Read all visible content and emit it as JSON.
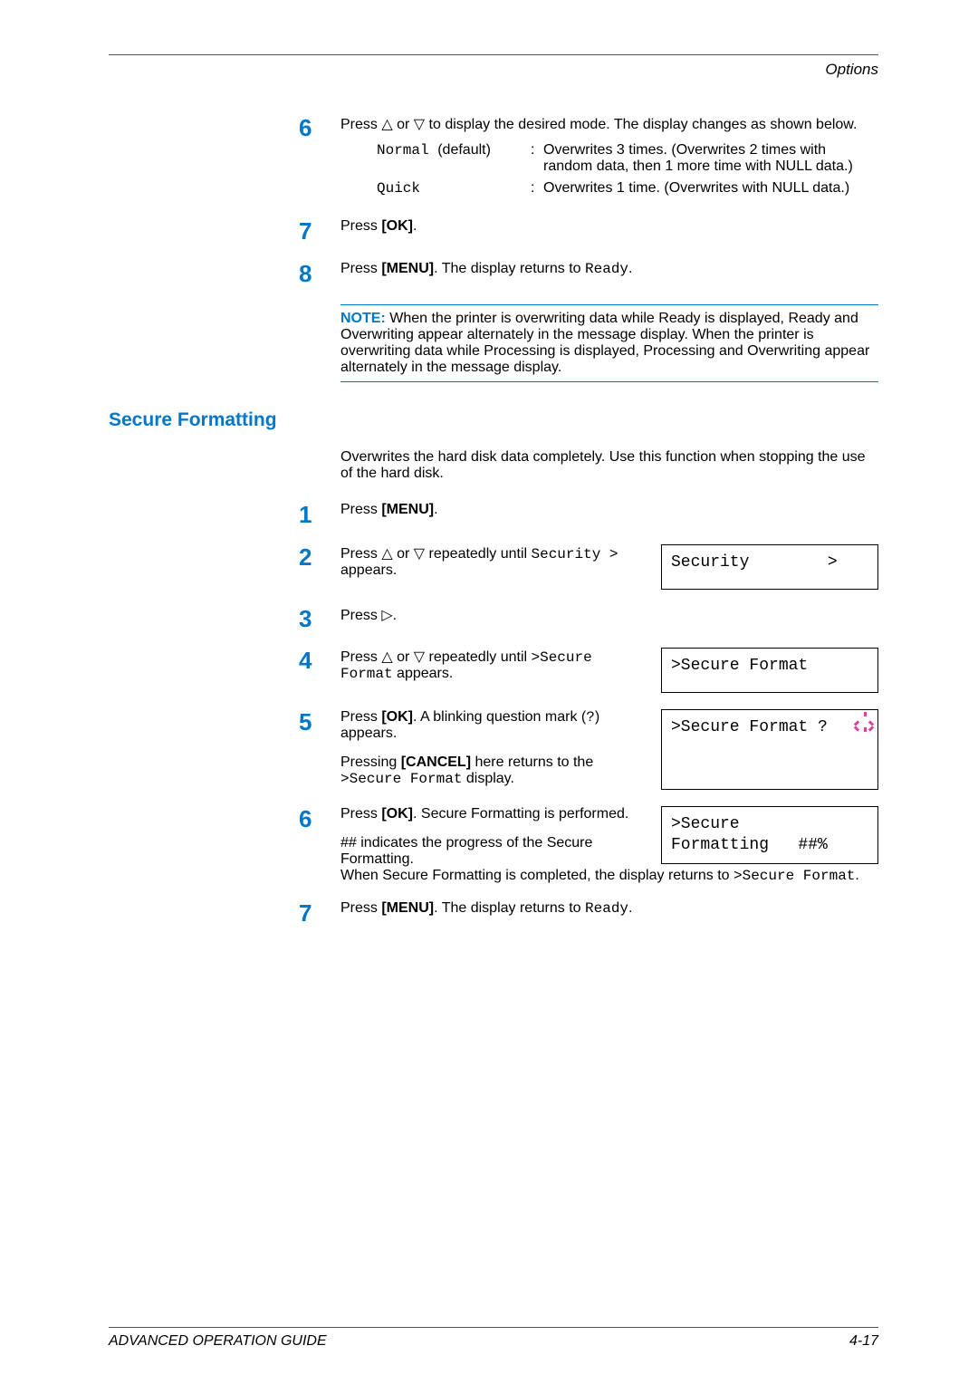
{
  "header": {
    "title": "Options"
  },
  "steps_a": [
    {
      "num": "6",
      "text": "Press △ or ▽ to display the desired mode. The display changes as shown below."
    },
    {
      "num": "7",
      "text": "Press ",
      "bold1": "[OK]",
      "tail": "."
    },
    {
      "num": "8",
      "text": "Press ",
      "bold1": "[MENU]",
      "tail": ". The display returns to ",
      "mono1": "Ready",
      "tail2": "."
    }
  ],
  "modes": {
    "k1_code": "Normal",
    "k1_paren": "(default)",
    "k1_desc": "Overwrites 3 times. (Overwrites 2 times with random data, then 1 more time with NULL data.)",
    "k2_code": "Quick",
    "k2_desc": "Overwrites 1 time. (Overwrites with NULL data.)"
  },
  "note": {
    "label": "NOTE:",
    "text": "When the printer is overwriting data while Ready is displayed, Ready and Overwriting appear alternately in the message display. When the printer is overwriting data while Processing is displayed, Processing and Overwriting appear alternately in the message display."
  },
  "section": {
    "title": "Secure Formatting",
    "intro": "Overwrites the hard disk data completely. Use this function when stopping the use of the hard disk."
  },
  "steps_b": {
    "s1": {
      "num": "1",
      "pre": "Press ",
      "bold": "[MENU]",
      "post": "."
    },
    "s2": {
      "num": "2",
      "pre": "Press △ or ▽ repeatedly until ",
      "mono": "Security >",
      "post": " appears.",
      "display": "Security        >"
    },
    "s3": {
      "num": "3",
      "pre": "Press ▷."
    },
    "s4": {
      "num": "4",
      "pre": "Press △ or ▽ repeatedly until ",
      "mono": ">Secure Format",
      "post": " appears.",
      "display": ">Secure Format"
    },
    "s5": {
      "num": "5",
      "pre": "Press ",
      "bold": "[OK]",
      "post": ". A blinking question mark (",
      "mono": "?",
      "post2": ") appears.",
      "line2": "Pressing ",
      "bold2": "[CANCEL]",
      "line2post": " here returns to the ",
      "mono2": ">Secure Format",
      "line2tail": " display.",
      "display": ">Secure Format ?"
    },
    "s6": {
      "num": "6",
      "pre": "Press ",
      "bold": "[OK]",
      "post": ". Secure Formatting is performed.",
      "para2a": "## indicates the progress of the Secure Formatting.",
      "para2b1": "When Secure Formatting is completed, the display returns to ",
      "mono3": ">Secure Format",
      "para2b2": ".",
      "display": ">Secure\nFormatting   ##%"
    },
    "s7": {
      "num": "7",
      "pre": "Press ",
      "bold": "[MENU]",
      "post": ". The display returns to ",
      "mono": "Ready",
      "post2": "."
    }
  },
  "footer": {
    "left": "ADVANCED OPERATION GUIDE",
    "right": "4-17"
  }
}
